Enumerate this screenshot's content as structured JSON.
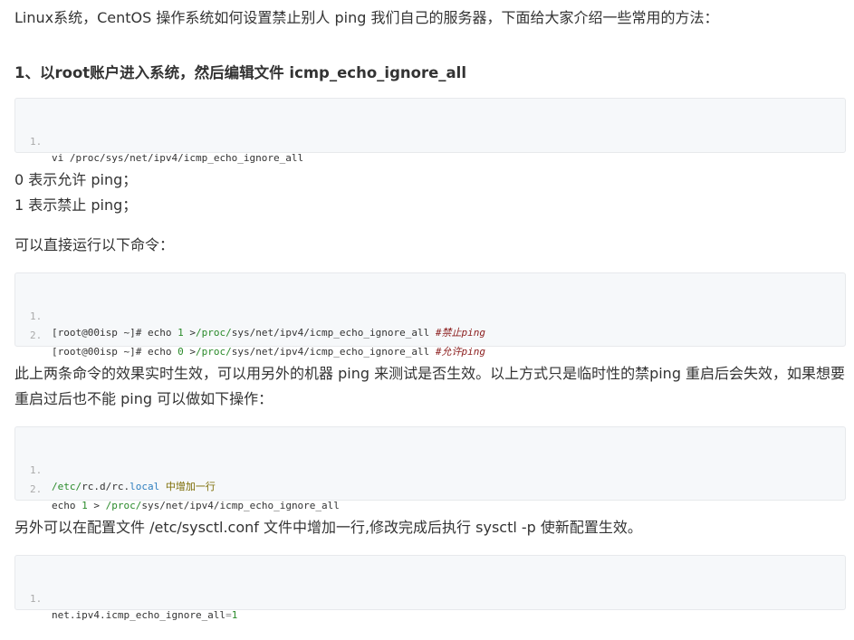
{
  "intro": "Linux系统，CentOS 操作系统如何设置禁止别人 ping 我们自己的服务器，下面给大家介绍一些常用的方法：",
  "step1_heading": "1、以root账户进入系统，然后编辑文件 icmp_echo_ignore_all",
  "code1": {
    "ln1": "1.",
    "cmd": "vi ",
    "path": "/proc/sys/net/ipv4/icmp_echo_ignore_all"
  },
  "desc0": "0 表示允许 ping；",
  "desc1": "1 表示禁止 ping；",
  "run_intro": "可以直接运行以下命令：",
  "code2": {
    "ln1": "1.",
    "ln2": "2.",
    "prompt": "[root@00isp ~]# ",
    "echo": "echo ",
    "v1": "1",
    "v0": "0",
    "redir": " >",
    "proc": "/proc/",
    "rest": "sys/net/ipv4/icmp_echo_ignore_all ",
    "comment1": "#禁止ping",
    "comment0": "#允许ping"
  },
  "note": "此上两条命令的效果实时生效，可以用另外的机器 ping 来测试是否生效。以上方式只是临时性的禁ping 重启后会失效，如果想要重启过后也不能 ping 可以做如下操作：",
  "code3": {
    "ln1": "1.",
    "ln2": "2.",
    "etc": "/etc/",
    "rcd": "rc.d/rc.",
    "local": "local",
    "add": " 中增加一行",
    "echo": "echo ",
    "v1": "1",
    "redir": " > ",
    "proc": "/proc/",
    "rest": "sys/net/ipv4/icmp_echo_ignore_all"
  },
  "sysctl_text": "另外可以在配置文件 /etc/sysctl.conf 文件中增加一行,修改完成后执行 sysctl -p 使新配置生效。",
  "code4": {
    "ln1": "1.",
    "key": "net.ipv4.icmp_echo_ignore_all",
    "eq": "=",
    "val": "1"
  }
}
